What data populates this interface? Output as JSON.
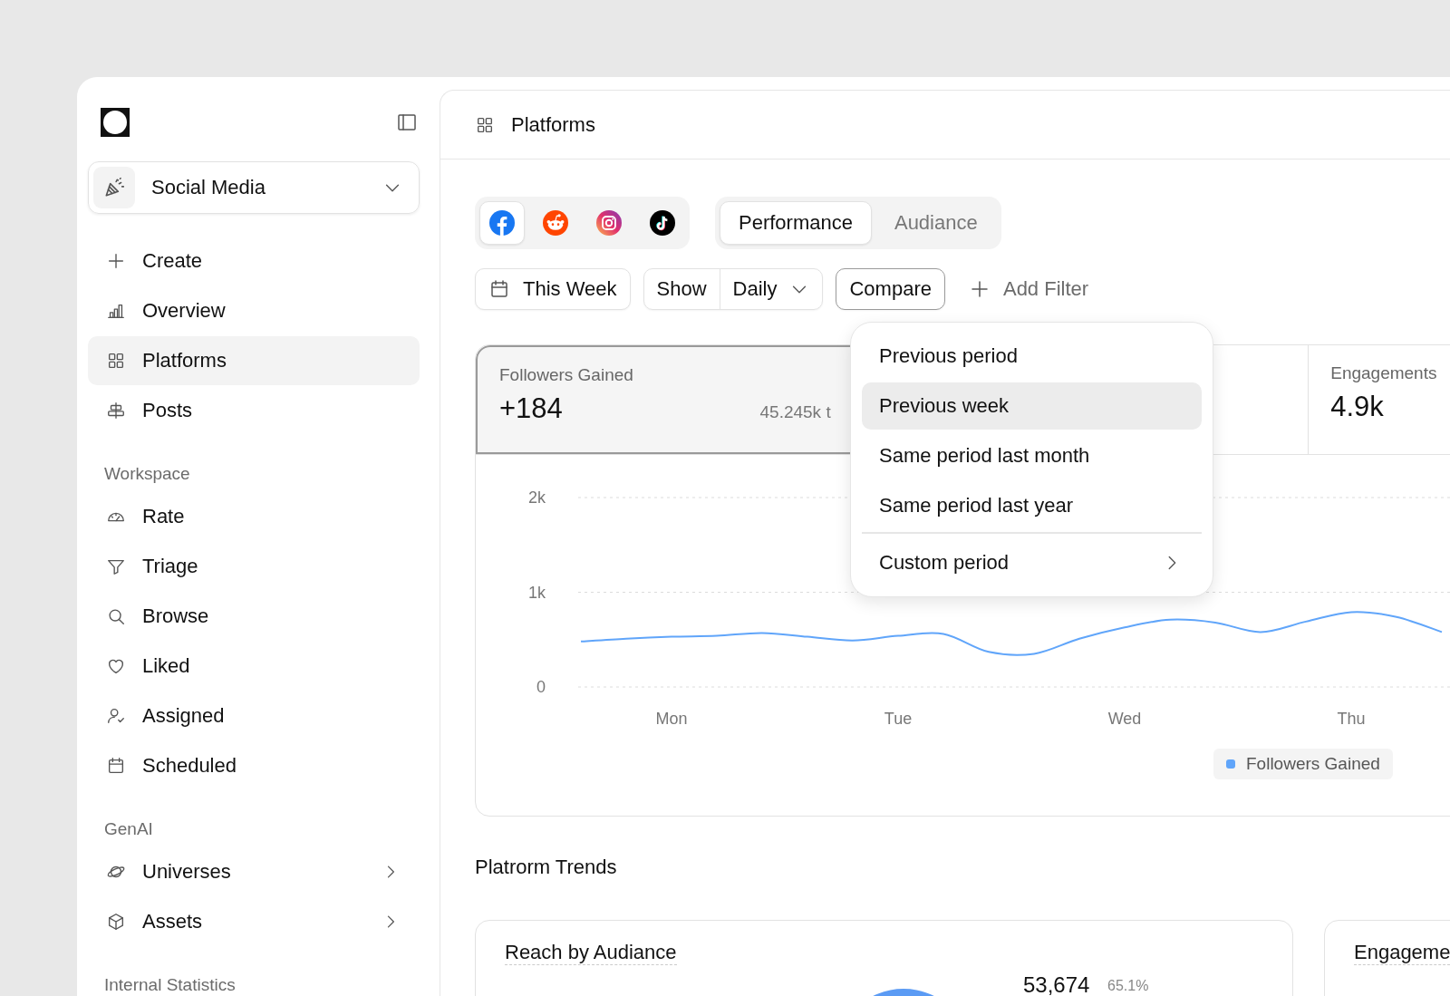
{
  "sidebar": {
    "workspace": "Social Media",
    "sections": [
      {
        "items": [
          {
            "label": "Create",
            "selected": false
          },
          {
            "label": "Overview",
            "selected": false
          },
          {
            "label": "Platforms",
            "selected": true
          },
          {
            "label": "Posts",
            "selected": false
          }
        ]
      },
      {
        "title": "Workspace",
        "items": [
          {
            "label": "Rate",
            "selected": false
          },
          {
            "label": "Triage",
            "selected": false
          },
          {
            "label": "Browse",
            "selected": false
          },
          {
            "label": "Liked",
            "selected": false
          },
          {
            "label": "Assigned",
            "selected": false
          },
          {
            "label": "Scheduled",
            "selected": false
          }
        ]
      },
      {
        "title": "GenAI",
        "items": [
          {
            "label": "Universes",
            "selected": false,
            "submenu": true
          },
          {
            "label": "Assets",
            "selected": false,
            "submenu": true
          }
        ]
      },
      {
        "title": "Internal Statistics"
      }
    ]
  },
  "header": {
    "title": "Platforms"
  },
  "platforms": [
    {
      "kind": "facebook",
      "selected": true
    },
    {
      "kind": "reddit",
      "selected": false
    },
    {
      "kind": "instagram",
      "selected": false
    },
    {
      "kind": "tiktok",
      "selected": false
    }
  ],
  "tabs": [
    {
      "label": "Performance",
      "selected": true
    },
    {
      "label": "Audiance",
      "selected": false
    }
  ],
  "filters": {
    "date": "This Week",
    "show_label": "Show",
    "show_value": "Daily",
    "compare": "Compare",
    "add_filter": "Add Filter"
  },
  "metrics": [
    {
      "label": "Followers Gained",
      "value": "+184",
      "note": "45.245k t",
      "selected": true
    },
    {
      "label": "Engagements",
      "value": "4.9k",
      "selected": false
    }
  ],
  "chart_data": {
    "type": "line",
    "categories": [
      null,
      null,
      "Mon",
      null,
      null,
      null,
      null,
      "Tue",
      null,
      null,
      null,
      null,
      "Wed",
      null,
      null,
      null,
      null,
      "Thu",
      null,
      null
    ],
    "ylim": [
      0,
      2000
    ],
    "yticks": [
      {
        "value": 0,
        "label": "0"
      },
      {
        "value": 1000,
        "label": "1k"
      },
      {
        "value": 2000,
        "label": "2k"
      }
    ],
    "series": [
      {
        "name": "Followers Gained",
        "color": "#60a5fa",
        "values": [
          480,
          510,
          530,
          540,
          570,
          530,
          490,
          540,
          560,
          370,
          350,
          510,
          630,
          710,
          680,
          580,
          690,
          790,
          740,
          580
        ]
      }
    ]
  },
  "compare_menu": [
    {
      "label": "Previous period",
      "selected": false,
      "kind": "option"
    },
    {
      "label": "Previous week",
      "selected": true,
      "kind": "option"
    },
    {
      "label": "Same period last month",
      "selected": false,
      "kind": "option"
    },
    {
      "label": "Same period last year",
      "selected": false,
      "kind": "option"
    },
    {
      "label": "Custom period",
      "selected": false,
      "kind": "submenu"
    }
  ],
  "trends": {
    "title": "Platrorm Trends",
    "cards": [
      {
        "title": "Reach by Audiance",
        "value": "53,674",
        "share": "65.1%"
      },
      {
        "title": "Engageme"
      }
    ]
  }
}
